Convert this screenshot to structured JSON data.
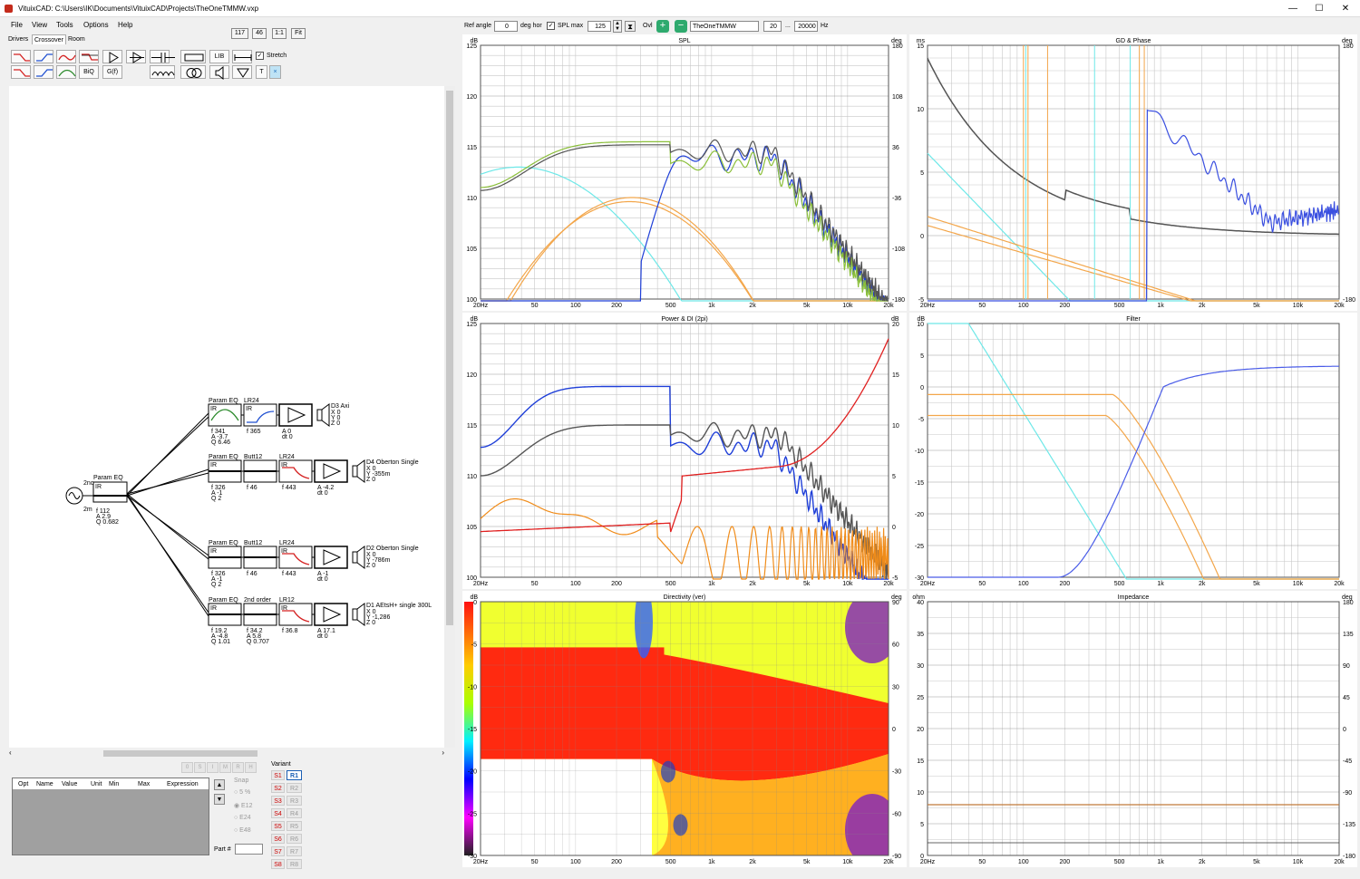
{
  "window": {
    "title": "VituixCAD: C:\\Users\\IK\\Documents\\VituixCAD\\Projects\\TheOneTMMW.vxp",
    "min": "—",
    "max": "☐",
    "close": "✕"
  },
  "menu": [
    "File",
    "View",
    "Tools",
    "Options",
    "Help"
  ],
  "tabs": [
    "Drivers",
    "Crossover",
    "Room"
  ],
  "zoom_buttons": [
    "117",
    "46",
    "1:1",
    "Fit"
  ],
  "toolbar": {
    "biq": "BiQ",
    "gt": "G(f)",
    "lib": "LIB",
    "stretch_label": "Stretch",
    "t_label": "T",
    "x_label": "×"
  },
  "schematic": {
    "source_labels": [
      "2no",
      "2m"
    ],
    "main_eq": {
      "title": "Param EQ",
      "ir": "IR",
      "params": "f  112\nA  2.9\nQ  0.682"
    },
    "rows": [
      {
        "blocks": [
          {
            "title": "Param EQ",
            "ir": "IR",
            "params": "f  341\nA  -3.7\nQ  6.46",
            "curve": "#2e8b2e"
          },
          {
            "title": "LR24",
            "ir": "IR",
            "params": "f  365",
            "curve": "#1f4fd1"
          },
          {
            "title": "",
            "ir": "",
            "params": "A  0\ndt 0",
            "curve": ""
          }
        ],
        "driver": "D3 Axi",
        "coords": "X 0\nY 0\nZ 0"
      },
      {
        "blocks": [
          {
            "title": "Param EQ",
            "ir": "IR",
            "params": "f  326\nA  -1\nQ  2",
            "curve": ""
          },
          {
            "title": "Butt12",
            "ir": "",
            "params": "f  46",
            "curve": ""
          },
          {
            "title": "LR24",
            "ir": "IR",
            "params": "f  443",
            "curve": "#d42020"
          },
          {
            "title": "",
            "ir": "",
            "params": "A  -4.2\ndt 0",
            "curve": ""
          }
        ],
        "driver": "D4 Oberton Single",
        "coords": "X 0\nY -355m\nZ 0"
      },
      {
        "blocks": [
          {
            "title": "Param EQ",
            "ir": "IR",
            "params": "f  326\nA  -1\nQ  2",
            "curve": ""
          },
          {
            "title": "Butt12",
            "ir": "",
            "params": "f  46",
            "curve": ""
          },
          {
            "title": "LR24",
            "ir": "IR",
            "params": "f  443",
            "curve": "#d42020"
          },
          {
            "title": "",
            "ir": "",
            "params": "A  -1\ndt 0",
            "curve": ""
          }
        ],
        "driver": "D2 Oberton Single",
        "coords": "X 0\nY -786m\nZ 0"
      },
      {
        "blocks": [
          {
            "title": "Param EQ",
            "ir": "IR",
            "params": "f  19.2\nA  -4.8\nQ  1.01",
            "curve": ""
          },
          {
            "title": "2nd order",
            "ir": "",
            "params": "f  34.2\nA  5.8\nQ  0.707",
            "curve": ""
          },
          {
            "title": "LR12",
            "ir": "IR",
            "params": "f  36.8",
            "curve": "#d42020"
          },
          {
            "title": "",
            "ir": "",
            "params": "A  17.1\ndt 0",
            "curve": ""
          }
        ],
        "driver": "D1 AEtsH+ single 300L",
        "coords": "X 0\nY -1,286\nZ 0"
      }
    ]
  },
  "optimizer": {
    "columns": [
      "Opt",
      "Name",
      "Value",
      "Unit",
      "Min",
      "Max",
      "Expression"
    ],
    "tiny_buttons": [
      "0",
      "S",
      "I",
      "M",
      "R",
      "H"
    ],
    "snap_label": "Snap",
    "snap_options": [
      "5 %",
      "E12",
      "E24",
      "E48"
    ],
    "part_label": "Part #",
    "variant_label": "Variant",
    "s_buttons": [
      "S1",
      "S2",
      "S3",
      "S4",
      "S5",
      "S6",
      "S7",
      "S8"
    ],
    "r_buttons": [
      "R1",
      "R2",
      "R3",
      "R4",
      "R5",
      "R6",
      "R7",
      "R8"
    ]
  },
  "right_toolbar": {
    "ref_angle_label": "Ref angle",
    "ref_angle": "0",
    "deg_hor": "deg hor",
    "spl_max_label": "SPL max",
    "spl_max": "125",
    "ovl_label": "Ovl",
    "project": "TheOneTMMW",
    "fmin": "20",
    "dots": "...",
    "fmax": "20000",
    "hz": "Hz"
  },
  "x_ticks": [
    "20Hz",
    "50",
    "100",
    "200",
    "500",
    "1k",
    "2k",
    "5k",
    "10k",
    "20k"
  ],
  "charts": {
    "spl": {
      "title": "SPL",
      "left_unit": "dB",
      "right_unit": "deg",
      "left_ticks": [
        "125",
        "120",
        "115",
        "110",
        "105",
        "100"
      ],
      "right_ticks": [
        "180",
        "108",
        "36",
        "-36",
        "-108",
        "-180"
      ]
    },
    "gd": {
      "title": "GD & Phase",
      "left_unit": "ms",
      "right_unit": "deg",
      "left_ticks": [
        "15",
        "10",
        "5",
        "0",
        "-5"
      ],
      "right_ticks": [
        "180",
        "",
        "",
        "",
        "-180"
      ]
    },
    "power": {
      "title": "Power & DI (2pi)",
      "left_unit": "dB",
      "right_unit": "dB",
      "left_ticks": [
        "125",
        "120",
        "115",
        "110",
        "105",
        "100"
      ],
      "right_ticks": [
        "20",
        "15",
        "10",
        "5",
        "0",
        "-5"
      ]
    },
    "filter": {
      "title": "Filter",
      "left_unit": "dB",
      "right_unit": "",
      "left_ticks": [
        "10",
        "5",
        "0",
        "-5",
        "-10",
        "-15",
        "-20",
        "-25",
        "-30"
      ],
      "right_ticks": []
    },
    "directivity": {
      "title": "Directivity (ver)",
      "left_unit": "dB",
      "right_unit": "deg",
      "left_ticks": [
        "0",
        "-5",
        "-10",
        "-15",
        "-20",
        "-25",
        "-30"
      ],
      "right_ticks": [
        "90",
        "60",
        "30",
        "0",
        "-30",
        "-60",
        "-90"
      ]
    },
    "impedance": {
      "title": "Impedance",
      "left_unit": "ohm",
      "right_unit": "deg",
      "left_ticks": [
        "40",
        "35",
        "30",
        "25",
        "20",
        "15",
        "10",
        "5",
        "0"
      ],
      "right_ticks": [
        "180",
        "135",
        "90",
        "45",
        "0",
        "-45",
        "-90",
        "-135",
        "-180"
      ]
    }
  },
  "colors": {
    "grid": "#c8c8c8",
    "axis": "#555555",
    "black": "#555555",
    "green": "#8bbf3a",
    "cyan": "#6ee8e8",
    "orange": "#f3a64a",
    "blue": "#1f3fd8",
    "red": "#e02020",
    "brown": "#c07a3a"
  }
}
